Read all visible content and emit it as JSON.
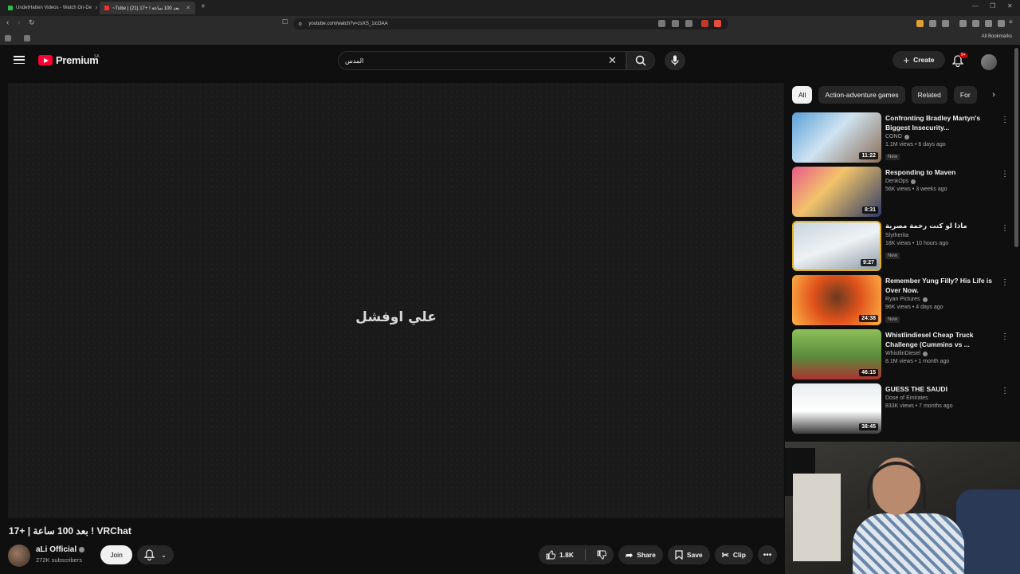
{
  "browser": {
    "tabs": [
      {
        "title": "UndetHatten Videos - Watch On-De",
        "favicon_color": "#27c24c",
        "active": false
      },
      {
        "title": "~Tube | بعد 100 ساعة ! +17 (21)",
        "favicon_color": "#ff2d2d",
        "active": true
      }
    ],
    "new_tab": "+",
    "url": "youtube.com/watch?v=zsXS_1icOAA",
    "all_bookmarks": "All Bookmarks"
  },
  "header": {
    "logo_text": "Premium",
    "logo_sup": "SA",
    "search_value": "المدس",
    "create_label": "Create",
    "notif_badge": "9+"
  },
  "player": {
    "caption": "علي اوفشل"
  },
  "video": {
    "title": "17+ | بعد 100 ساعة ! VRChat",
    "channel_name": "aLi Official",
    "subscribers": "272K subscribers",
    "join_label": "Join",
    "likes": "1.8K",
    "share_label": "Share",
    "save_label": "Save",
    "clip_label": "Clip"
  },
  "chips": [
    "All",
    "Action-adventure games",
    "Related",
    "For"
  ],
  "recommendations": [
    {
      "title": "Confronting Bradley Martyn's Biggest Insecurity...",
      "channel": "CONO",
      "verified": true,
      "meta": "1.1M views • 6 days ago",
      "badge": "New",
      "duration": "11:22",
      "thumb": "linear-gradient(135deg,#5aa0d8 0%,#cfe3f0 45%,#8a6d57 100%)"
    },
    {
      "title": "Responding to Maven",
      "channel": "DenkOps",
      "verified": true,
      "meta": "56K views • 3 weeks ago",
      "badge": "",
      "duration": "8:31",
      "thumb": "linear-gradient(135deg,#e85a8a 0%,#f2c46a 40%,#2e3b66 100%)"
    },
    {
      "title": "ماذا لو كنت رخمة مصرية",
      "channel": "Slytherita",
      "verified": false,
      "meta": "18K views • 10 hours ago",
      "badge": "New",
      "duration": "9:27",
      "thumb": "linear-gradient(160deg,#c9d4de 0%,#eef2f5 50%,#8f9ba6 100%)"
    },
    {
      "title": "Remember Yung Filly? His Life is Over Now.",
      "channel": "Ryan Pictures",
      "verified": true,
      "meta": "96K views • 4 days ago",
      "badge": "New",
      "duration": "24:38",
      "thumb": "radial-gradient(circle at 50% 45%,#6b3a20 0%,#e0521b 45%,#ffb347 100%)"
    },
    {
      "title": "Whistlindiesel Cheap Truck Challenge (Cummins vs ...",
      "channel": "WhistlinDiesel",
      "verified": true,
      "meta": "8.1M views • 1 month ago",
      "badge": "",
      "duration": "46:15",
      "thumb": "linear-gradient(180deg,#8fbf5a 0%,#5b8a3c 55%,#a33 100%)"
    },
    {
      "title": "GUESS THE SAUDI",
      "channel": "Dose of Emirates",
      "verified": false,
      "meta": "833K views • 7 months ago",
      "badge": "",
      "duration": "38:45",
      "thumb": "linear-gradient(180deg,#e9ecef 0%,#ffffff 55%,#3a3a3a 100%)"
    }
  ]
}
